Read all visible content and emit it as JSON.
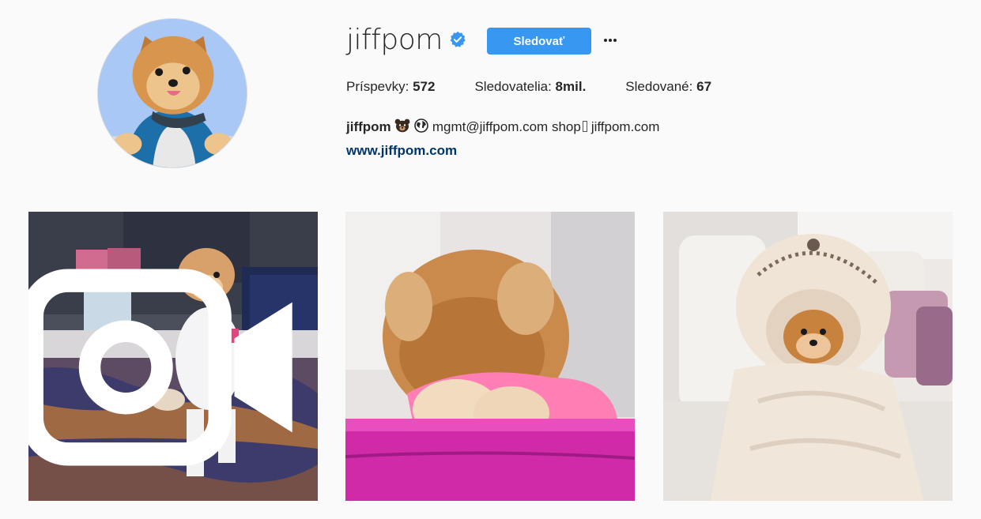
{
  "profile": {
    "username": "jiffpom",
    "verified": true,
    "follow_label": "Sledovať",
    "more_label": "···",
    "accent_color": "#3897f0"
  },
  "stats": {
    "posts_label": "Príspevky:",
    "posts_value": "572",
    "followers_label": "Sledovatelia:",
    "followers_value": "8mil.",
    "following_label": "Sledované:",
    "following_value": "67"
  },
  "bio": {
    "name": "jiffpom",
    "text": "mgmt@jiffpom.com shop",
    "shop_text": "jiffpom.com",
    "link": "www.jiffpom.com",
    "link_color": "#003569"
  },
  "posts": [
    {
      "kind": "video",
      "icon": "video-camera-icon"
    },
    {
      "kind": "photo"
    },
    {
      "kind": "photo"
    }
  ]
}
